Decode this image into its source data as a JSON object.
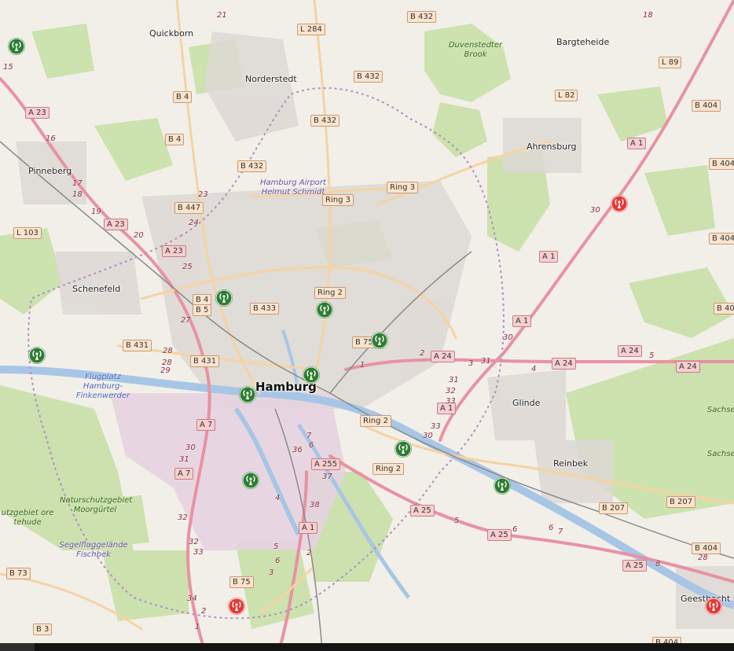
{
  "map": {
    "places": [
      {
        "name": "Quickborn",
        "kind": "town"
      },
      {
        "name": "Norderstedt",
        "kind": "town"
      },
      {
        "name": "Bargteheide",
        "kind": "town"
      },
      {
        "name": "Ahrensburg",
        "kind": "town"
      },
      {
        "name": "Pinneberg",
        "kind": "town"
      },
      {
        "name": "Schenefeld",
        "kind": "town"
      },
      {
        "name": "Hamburg",
        "kind": "city"
      },
      {
        "name": "Glinde",
        "kind": "town"
      },
      {
        "name": "Reinbek",
        "kind": "town"
      },
      {
        "name": "Geesthacht",
        "kind": "town"
      }
    ],
    "areas": [
      {
        "name": "Duvenstedter Brook",
        "kind": "area"
      },
      {
        "name": "Hamburg Airport Helmut Schmidt",
        "kind": "airport"
      },
      {
        "name": "Flugplatz Hamburg-Finkenwerder",
        "kind": "airport-water"
      },
      {
        "name": "Naturschutzgebiet Moorgürtel",
        "kind": "area"
      },
      {
        "name": "utzgebiet ore tehude",
        "kind": "area"
      },
      {
        "name": "Segelfluggelände Fischbek",
        "kind": "airport"
      },
      {
        "name": "Sachsenw",
        "kind": "area"
      },
      {
        "name": "Sachsenw",
        "kind": "area"
      }
    ],
    "roads": [
      {
        "ref": "B 432",
        "type": "primary"
      },
      {
        "ref": "L 284",
        "type": "primary"
      },
      {
        "ref": "B 4",
        "type": "primary"
      },
      {
        "ref": "B 432",
        "type": "primary"
      },
      {
        "ref": "B 4",
        "type": "primary"
      },
      {
        "ref": "B 432",
        "type": "primary"
      },
      {
        "ref": "A 23",
        "type": "motorway"
      },
      {
        "ref": "B 432",
        "type": "primary"
      },
      {
        "ref": "Ring 3",
        "type": "primary"
      },
      {
        "ref": "Ring 3",
        "type": "primary"
      },
      {
        "ref": "B 447",
        "type": "primary"
      },
      {
        "ref": "A 23",
        "type": "motorway"
      },
      {
        "ref": "A 23",
        "type": "motorway"
      },
      {
        "ref": "L 103",
        "type": "primary"
      },
      {
        "ref": "B 4",
        "type": "primary"
      },
      {
        "ref": "B 5",
        "type": "primary"
      },
      {
        "ref": "B 433",
        "type": "primary"
      },
      {
        "ref": "Ring 2",
        "type": "primary"
      },
      {
        "ref": "B 431",
        "type": "primary"
      },
      {
        "ref": "B 75",
        "type": "primary"
      },
      {
        "ref": "A 24",
        "type": "motorway"
      },
      {
        "ref": "B 431",
        "type": "primary"
      },
      {
        "ref": "A 24",
        "type": "motorway"
      },
      {
        "ref": "A 24",
        "type": "motorway"
      },
      {
        "ref": "A 24",
        "type": "motorway"
      },
      {
        "ref": "A 1",
        "type": "motorway"
      },
      {
        "ref": "A 7",
        "type": "motorway"
      },
      {
        "ref": "Ring 2",
        "type": "primary"
      },
      {
        "ref": "A 7",
        "type": "motorway"
      },
      {
        "ref": "A 255",
        "type": "motorway"
      },
      {
        "ref": "Ring 2",
        "type": "primary"
      },
      {
        "ref": "A 25",
        "type": "motorway"
      },
      {
        "ref": "A 25",
        "type": "motorway"
      },
      {
        "ref": "A 1",
        "type": "motorway"
      },
      {
        "ref": "B 207",
        "type": "primary"
      },
      {
        "ref": "B 207",
        "type": "primary"
      },
      {
        "ref": "B 404",
        "type": "primary"
      },
      {
        "ref": "A 25",
        "type": "motorway"
      },
      {
        "ref": "B 75",
        "type": "primary"
      },
      {
        "ref": "B 73",
        "type": "primary"
      },
      {
        "ref": "B 3",
        "type": "primary"
      },
      {
        "ref": "B 404",
        "type": "primary"
      },
      {
        "ref": "L 89",
        "type": "primary"
      },
      {
        "ref": "L 82",
        "type": "primary"
      },
      {
        "ref": "B 404",
        "type": "primary"
      },
      {
        "ref": "A 1",
        "type": "motorway"
      },
      {
        "ref": "B 404",
        "type": "primary"
      },
      {
        "ref": "B 404",
        "type": "primary"
      },
      {
        "ref": "A 1",
        "type": "motorway"
      },
      {
        "ref": "A 1",
        "type": "motorway"
      },
      {
        "ref": "B 40",
        "type": "primary"
      },
      {
        "ref": "A 1",
        "type": "motorway"
      }
    ],
    "exits": [
      "21",
      "18",
      "15",
      "16",
      "17",
      "18",
      "19",
      "20",
      "23",
      "24",
      "25",
      "27",
      "28",
      "28",
      "29",
      "2",
      "1",
      "3",
      "31",
      "4",
      "5",
      "30",
      "31",
      "32",
      "33",
      "33",
      "30",
      "30",
      "31",
      "32",
      "32",
      "33",
      "34",
      "2",
      "1",
      "7",
      "6",
      "36",
      "37",
      "38",
      "2",
      "4",
      "5",
      "6",
      "3",
      "5",
      "6",
      "6",
      "7",
      "8",
      "28",
      "30"
    ],
    "stations": [
      {
        "status": "active",
        "color": "#2e7d32"
      },
      {
        "status": "active",
        "color": "#2e7d32"
      },
      {
        "status": "active",
        "color": "#2e7d32"
      },
      {
        "status": "active",
        "color": "#2e7d32"
      },
      {
        "status": "active",
        "color": "#2e7d32"
      },
      {
        "status": "active",
        "color": "#2e7d32"
      },
      {
        "status": "active",
        "color": "#2e7d32"
      },
      {
        "status": "active",
        "color": "#2e7d32"
      },
      {
        "status": "active",
        "color": "#2e7d32"
      },
      {
        "status": "active",
        "color": "#2e7d32"
      },
      {
        "status": "inactive",
        "color": "#e53935"
      },
      {
        "status": "inactive",
        "color": "#e53935"
      },
      {
        "status": "inactive",
        "color": "#e53935"
      }
    ],
    "marker_icon": "antenna-icon"
  }
}
